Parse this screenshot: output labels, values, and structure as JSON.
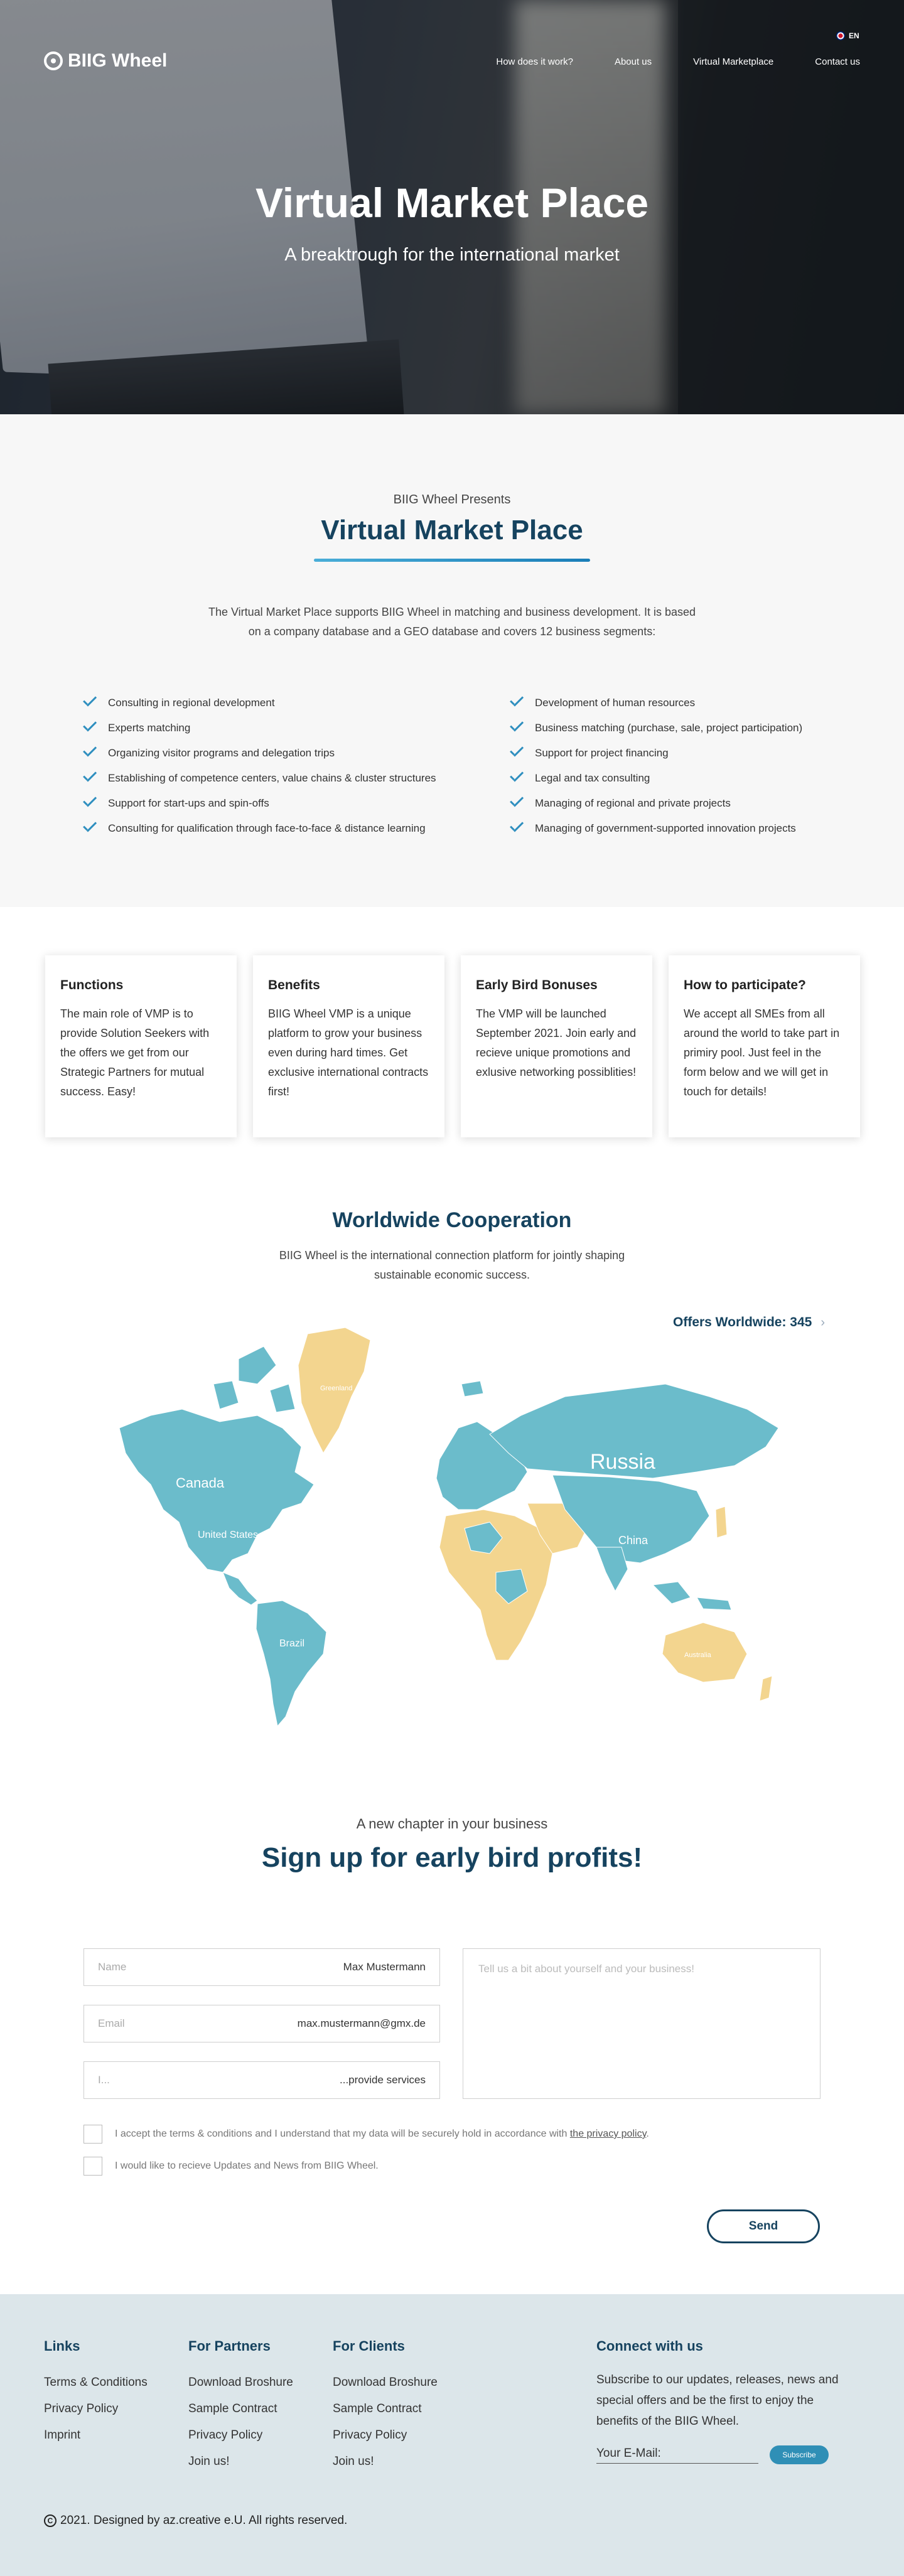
{
  "header": {
    "logo_text": "BIIG Wheel",
    "language": "EN",
    "nav": [
      "How does it work?",
      "About us",
      "Virtual Marketplace",
      "Contact us"
    ]
  },
  "hero": {
    "title": "Virtual Market Place",
    "subtitle": "A breaktrough for the international market"
  },
  "intro": {
    "presents": "BIIG Wheel Presents",
    "title": "Virtual Market Place",
    "description": "The Virtual Market Place supports BIIG Wheel in matching and business development. It is based on a   company database and a GEO database and covers 12 business segments:",
    "features_left": [
      "Consulting in regional development",
      "Experts matching",
      "Organizing visitor programs and delegation trips",
      "Establishing of competence centers, value chains & cluster structures",
      "Support for start-ups and spin-offs",
      "Consulting for qualification through   face-to-face & distance learning"
    ],
    "features_right": [
      "Development of human resources",
      "Business matching (purchase, sale, project participation)",
      "Support for project financing",
      "Legal and tax consulting",
      "Managing of regional and private projects",
      "Managing of government-supported innovation projects"
    ]
  },
  "cards": [
    {
      "title": "Functions",
      "text": "The main role of VMP is to provide Solution Seekers with the offers we get from our Strategic Partners for mutual success. Easy!"
    },
    {
      "title": "Benefits",
      "text": "BIIG Wheel VMP is a unique platform to grow your business even during hard times. Get exclusive international contracts first!"
    },
    {
      "title": "Early Bird Bonuses",
      "text": "The VMP will be launched September 2021. Join early and recieve unique promotions and exlusive networking possiblities!"
    },
    {
      "title": "How to participate?",
      "text": "We accept all SMEs from all around the world to take part in primiry pool. Just feel in the form below and we will get in touch for details!"
    }
  ],
  "world": {
    "title": "Worldwide Cooperation",
    "description": "BIIG Wheel is the international connection platform for jointly shaping   sustainable economic success.",
    "offers_label": "Offers Worldwide: 345",
    "map_labels": {
      "russia": "Russia",
      "canada": "Canada",
      "us": "United States",
      "china": "China",
      "brazil": "Brazil",
      "greenland": "Greenland",
      "australia": "Australia"
    },
    "colors": {
      "member": "#6bbccb",
      "other": "#f3d58f"
    }
  },
  "signup": {
    "chapter": "A new chapter in your business",
    "title": "Sign up for early bird profits!",
    "name_placeholder": "Name",
    "name_value": "Max Mustermann",
    "email_placeholder": "Email",
    "email_value": "max.mustermann@gmx.de",
    "role_placeholder": "I...",
    "role_value": "...provide services",
    "message_placeholder": "Tell us a bit about yourself and your business!",
    "terms_text": "I accept the terms & conditions and I understand that my data will be securely hold in accordance with ",
    "terms_link": "the privacy policy",
    "newsletter_text": "I would like to recieve Updates and News from BIIG Wheel.",
    "send": "Send"
  },
  "footer": {
    "links": {
      "title": "Links",
      "items": [
        "Terms & Conditions",
        "Privacy Policy",
        "Imprint"
      ]
    },
    "partners": {
      "title": "For Partners",
      "items": [
        "Download Broshure",
        "Sample Contract",
        "Privacy Policy",
        "Join us!"
      ]
    },
    "clients": {
      "title": "For Clients",
      "items": [
        "Download Broshure",
        "Sample Contract",
        "Privacy Policy",
        "Join us!"
      ]
    },
    "connect": {
      "title": "Connect with us",
      "text": "Subscribe to our updates, releases, news and special offers and be the first to enjoy the benefits of the BIIG Wheel.",
      "email_label": "Your E-Mail:",
      "subscribe": "Subscribe"
    },
    "copyright": "2021. Designed by az.creative e.U.  All rights reserved."
  }
}
